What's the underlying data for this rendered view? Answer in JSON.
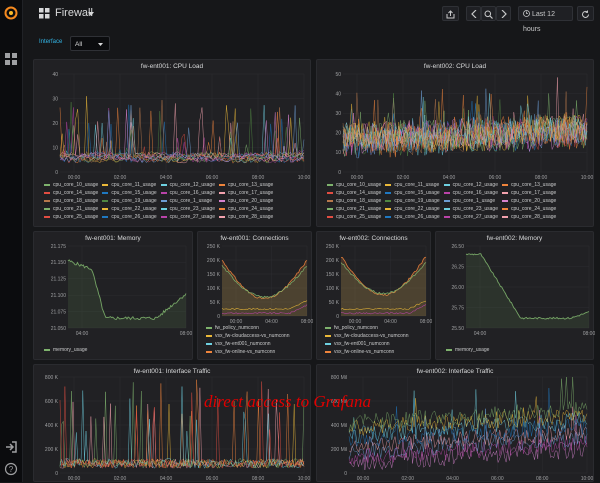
{
  "colors": {
    "green": "#7eb26d",
    "yellow": "#eab839",
    "cyan": "#6ed0e0",
    "orange": "#ef843c",
    "red": "#e24d42",
    "blue": "#1f78c1",
    "purple": "#ba43a9",
    "pink": "#f2a1ad",
    "brown": "#b7784c",
    "teal": "#508642",
    "lightblue": "#6d9dd4",
    "magenta": "#d683ce"
  },
  "header": {
    "title": "Firewall",
    "time_range": "Last 12 hours",
    "icons": [
      "grafana-logo-icon",
      "dashboards-grid-icon",
      "share-icon",
      "chevron-left-icon",
      "zoom-out-icon",
      "chevron-right-icon",
      "clock-icon",
      "refresh-icon"
    ]
  },
  "sidebar": {
    "icons": [
      "grafana-logo-icon",
      "apps-icon",
      "sign-in-icon",
      "help-icon"
    ]
  },
  "variables": {
    "label": "Interface",
    "value": "All"
  },
  "panels": {
    "cpu1": {
      "title": "fw-ent001: CPU Load",
      "yticks": [
        "40",
        "30",
        "20",
        "10",
        "0"
      ],
      "xticks": [
        "00:00",
        "02:00",
        "04:00",
        "06:00",
        "08:00",
        "10:00"
      ],
      "legend": [
        "cpu_core_10_usage",
        "cpu_core_11_usage",
        "cpu_core_12_usage",
        "cpu_core_13_usage",
        "cpu_core_14_usage",
        "cpu_core_15_usage",
        "cpu_core_16_usage",
        "cpu_core_17_usage",
        "cpu_core_18_usage",
        "cpu_core_19_usage",
        "cpu_core_1_usage",
        "cpu_core_20_usage",
        "cpu_core_21_usage",
        "cpu_core_22_usage",
        "cpu_core_23_usage",
        "cpu_core_24_usage",
        "cpu_core_25_usage",
        "cpu_core_26_usage",
        "cpu_core_27_usage",
        "cpu_core_28_usage"
      ]
    },
    "cpu2": {
      "title": "fw-ent002: CPU Load",
      "yticks": [
        "50",
        "40",
        "30",
        "20",
        "10",
        "0"
      ],
      "xticks": [
        "00:00",
        "02:00",
        "04:00",
        "06:00",
        "08:00",
        "10:00"
      ],
      "legend": [
        "cpu_core_10_usage",
        "cpu_core_11_usage",
        "cpu_core_12_usage",
        "cpu_core_13_usage",
        "cpu_core_14_usage",
        "cpu_core_15_usage",
        "cpu_core_16_usage",
        "cpu_core_17_usage",
        "cpu_core_18_usage",
        "cpu_core_19_usage",
        "cpu_core_1_usage",
        "cpu_core_20_usage",
        "cpu_core_21_usage",
        "cpu_core_22_usage",
        "cpu_core_23_usage",
        "cpu_core_24_usage",
        "cpu_core_25_usage",
        "cpu_core_26_usage",
        "cpu_core_27_usage",
        "cpu_core_28_usage"
      ]
    },
    "mem1": {
      "title": "fw-ent001: Memory",
      "yticks": [
        "21.175",
        "21.150",
        "21.125",
        "21.100",
        "21.075",
        "21.050"
      ],
      "xticks": [
        "04:00",
        "08:00"
      ],
      "legend": [
        "memory_usage"
      ]
    },
    "conn1": {
      "title": "fw-ent001: Connections",
      "yticks": [
        "250 K",
        "200 K",
        "150 K",
        "100 K",
        "50 K",
        "0"
      ],
      "xticks": [
        "00:00",
        "04:00",
        "08:00"
      ],
      "legend": [
        "fw_policy_numconn",
        "vsx_fw-cloudaccess-vs_numconn",
        "vsx_fw-ent001_numconn",
        "vsx_fw-online-vs_numconn"
      ]
    },
    "conn2": {
      "title": "fw-ent002: Connections",
      "yticks": [
        "250 K",
        "200 K",
        "150 K",
        "100 K",
        "50 K",
        "0"
      ],
      "xticks": [
        "00:00",
        "04:00",
        "08:00"
      ],
      "legend": [
        "fw_policy_numconn",
        "vsx_fw-cloudaccess-vs_numconn",
        "vsx_fw-ent001_numconn",
        "vsx_fw-online-vs_numconn"
      ]
    },
    "mem2": {
      "title": "fw-ent002: Memory",
      "yticks": [
        "26.50",
        "26.25",
        "26.00",
        "25.75",
        "25.50"
      ],
      "xticks": [
        "04:00",
        "08:00"
      ],
      "legend": [
        "memory_usage"
      ]
    },
    "if1": {
      "title": "fw-ent001: Interface Traffic",
      "yticks": [
        "800 K",
        "600 K",
        "400 K",
        "200 K",
        "0"
      ],
      "xticks": [
        "00:00",
        "02:00",
        "04:00",
        "06:00",
        "08:00",
        "10:00"
      ]
    },
    "if2": {
      "title": "fw-ent002: Interface Traffic",
      "yticks": [
        "800 Mil",
        "600 Mil",
        "400 Mil",
        "200 Mil",
        "0"
      ],
      "xticks": [
        "00:00",
        "02:00",
        "04:00",
        "06:00",
        "08:00",
        "10:00"
      ]
    }
  },
  "watermark": "direct access to Grafana"
}
